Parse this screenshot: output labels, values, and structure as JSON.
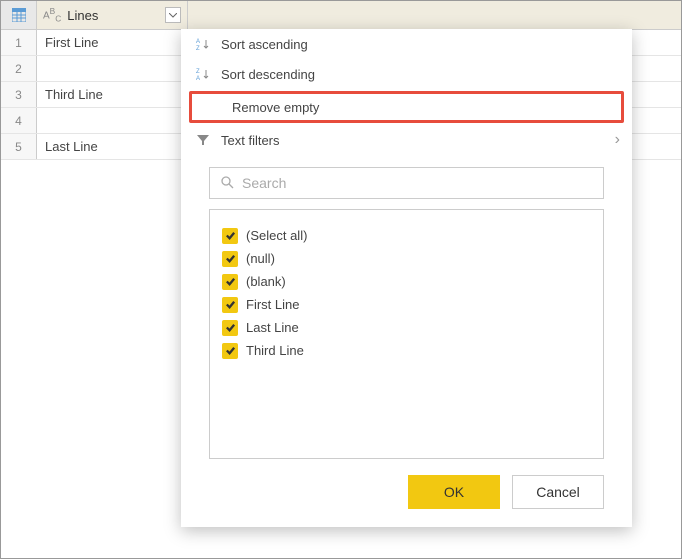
{
  "column": {
    "name": "Lines",
    "type_icon": "ABC"
  },
  "rows": [
    {
      "num": "1",
      "value": "First Line"
    },
    {
      "num": "2",
      "value": ""
    },
    {
      "num": "3",
      "value": "Third Line"
    },
    {
      "num": "4",
      "value": ""
    },
    {
      "num": "5",
      "value": "Last Line"
    }
  ],
  "menu": {
    "sort_asc": "Sort ascending",
    "sort_desc": "Sort descending",
    "remove_empty": "Remove empty",
    "text_filters": "Text filters"
  },
  "search": {
    "placeholder": "Search"
  },
  "values": [
    {
      "label": "(Select all)"
    },
    {
      "label": "(null)"
    },
    {
      "label": "(blank)"
    },
    {
      "label": "First Line"
    },
    {
      "label": "Last Line"
    },
    {
      "label": "Third Line"
    }
  ],
  "buttons": {
    "ok": "OK",
    "cancel": "Cancel"
  }
}
